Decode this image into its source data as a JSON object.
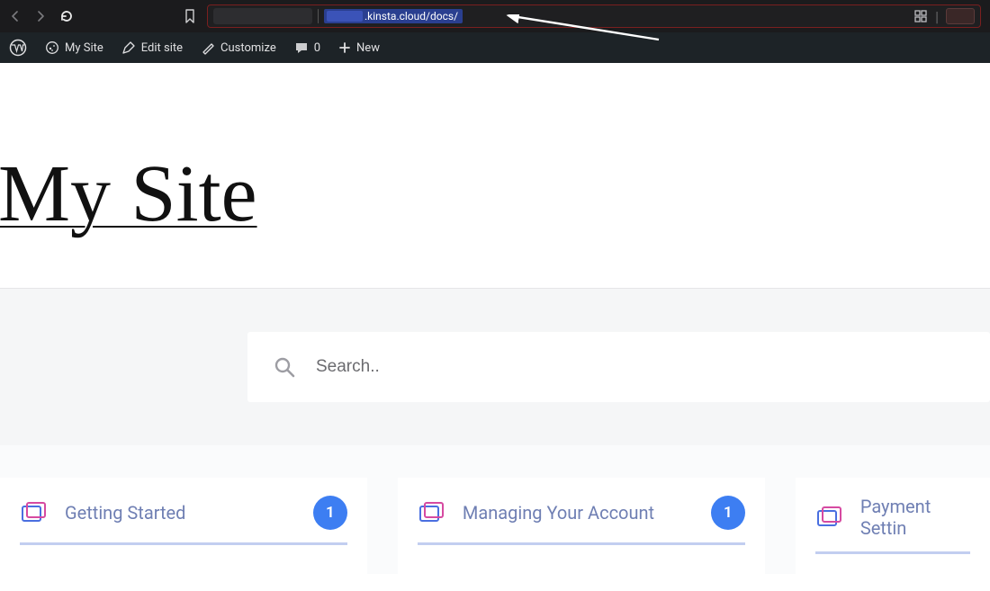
{
  "browser": {
    "url_visible_fragment": ".kinsta.cloud/docs/"
  },
  "wp_bar": {
    "site_name": "My Site",
    "edit_site": "Edit site",
    "customize": "Customize",
    "comments_count": "0",
    "new": "New"
  },
  "page": {
    "title": "My Site"
  },
  "search": {
    "placeholder": "Search.."
  },
  "cards": [
    {
      "title": "Getting Started",
      "count": "1"
    },
    {
      "title": "Managing Your Account",
      "count": "1"
    },
    {
      "title": "Payment Settin"
    }
  ]
}
